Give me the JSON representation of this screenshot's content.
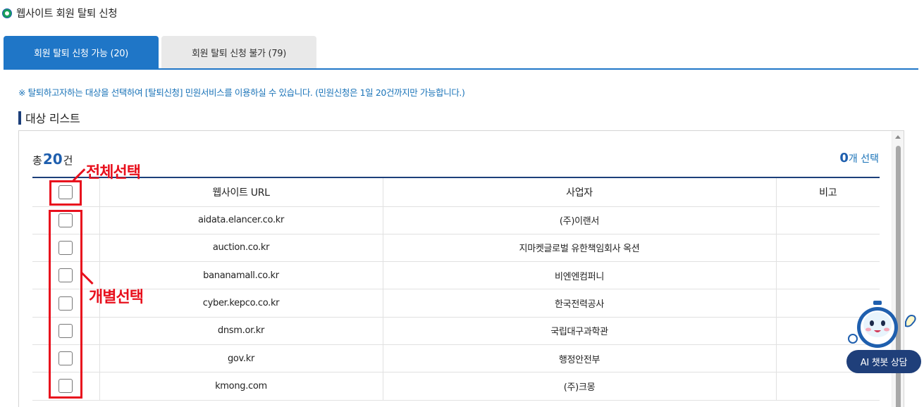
{
  "header": {
    "title": "웹사이트 회원 탈퇴 신청"
  },
  "tabs": [
    {
      "label": "회원 탈퇴 신청 가능 (20)",
      "active": true
    },
    {
      "label": "회원 탈퇴 신청 불가 (79)",
      "active": false
    }
  ],
  "notice": "※ 탈퇴하고자하는 대상을 선택하여 [탈퇴신청] 민원서비스를 이용하실 수 있습니다. (민원신청은 1일 20건까지만 가능합니다.)",
  "section": {
    "title": "대상 리스트"
  },
  "summary": {
    "total_prefix": "총",
    "total_count": "20",
    "total_suffix": "건",
    "selected_count": "0",
    "selected_suffix": "개 선택"
  },
  "table": {
    "headers": [
      "",
      "웹사이트 URL",
      "사업자",
      "비고"
    ],
    "rows": [
      {
        "url": "aidata.elancer.co.kr",
        "company": "(주)이랜서",
        "note": ""
      },
      {
        "url": "auction.co.kr",
        "company": "지마켓글로벌 유한책임회사 옥션",
        "note": ""
      },
      {
        "url": "bananamall.co.kr",
        "company": "비엔엔컴퍼니",
        "note": ""
      },
      {
        "url": "cyber.kepco.co.kr",
        "company": "한국전력공사",
        "note": ""
      },
      {
        "url": "dnsm.or.kr",
        "company": "국립대구과학관",
        "note": ""
      },
      {
        "url": "gov.kr",
        "company": "행정안전부",
        "note": ""
      },
      {
        "url": "kmong.com",
        "company": "(주)크몽",
        "note": ""
      }
    ]
  },
  "annotations": {
    "select_all": "전체선택",
    "select_each": "개별선택"
  },
  "chatbot": {
    "label": "AI 챗봇 상담"
  },
  "colors": {
    "primary": "#1f76c7",
    "navy": "#1c3f7a",
    "accent_red": "#e8101d",
    "notice_blue": "#1a73b8"
  }
}
